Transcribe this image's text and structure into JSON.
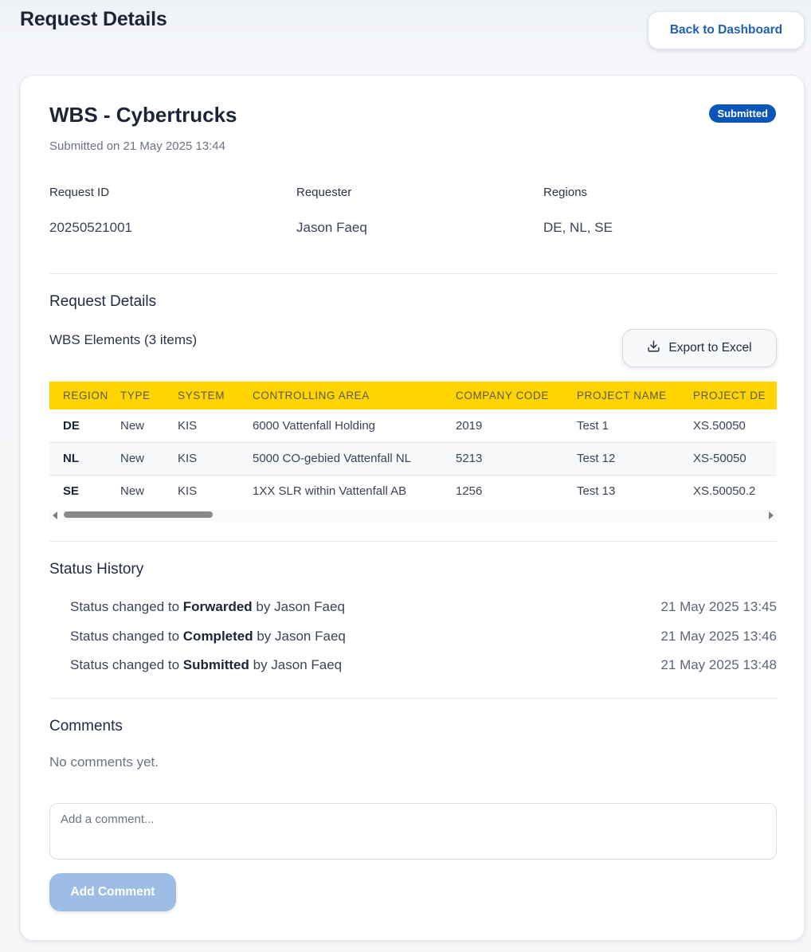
{
  "header": {
    "title": "Request Details",
    "back_label": "Back to Dashboard"
  },
  "request": {
    "title": "WBS - Cybertrucks",
    "submitted_on": "Submitted on 21 May 2025 13:44",
    "status": "Submitted",
    "status_color": "#0a56b8",
    "meta": [
      {
        "label": "Request ID",
        "value": "20250521001"
      },
      {
        "label": "Requester",
        "value": "Jason Faeq"
      },
      {
        "label": "Regions",
        "value": "DE, NL, SE"
      }
    ]
  },
  "details": {
    "heading": "Request Details",
    "elements_label": "WBS Elements (3 items)",
    "export_label": "Export to Excel",
    "export_icon": "download-icon",
    "header_color": "#ffd400",
    "columns": [
      "REGION",
      "TYPE",
      "SYSTEM",
      "CONTROLLING AREA",
      "COMPANY CODE",
      "PROJECT NAME",
      "PROJECT DE"
    ],
    "rows": [
      [
        "DE",
        "New",
        "KIS",
        "6000 Vattenfall Holding",
        "2019",
        "Test 1",
        "XS.50050"
      ],
      [
        "NL",
        "New",
        "KIS",
        "5000 CO-gebied Vattenfall NL",
        "5213",
        "Test 12",
        "XS-50050"
      ],
      [
        "SE",
        "New",
        "KIS",
        "1XX SLR within Vattenfall AB",
        "1256",
        "Test 13",
        "XS.50050.2"
      ]
    ]
  },
  "history": {
    "heading": "Status History",
    "items": [
      {
        "prefix": "Status changed to ",
        "status": "Forwarded",
        "suffix": " by Jason Faeq",
        "time": "21 May 2025 13:45"
      },
      {
        "prefix": "Status changed to ",
        "status": "Completed",
        "suffix": " by Jason Faeq",
        "time": "21 May 2025 13:46"
      },
      {
        "prefix": "Status changed to ",
        "status": "Submitted",
        "suffix": " by Jason Faeq",
        "time": "21 May 2025 13:48"
      }
    ]
  },
  "comments": {
    "heading": "Comments",
    "empty_text": "No comments yet.",
    "placeholder": "Add a comment...",
    "add_label": "Add Comment",
    "add_color": "#9dbde4"
  }
}
